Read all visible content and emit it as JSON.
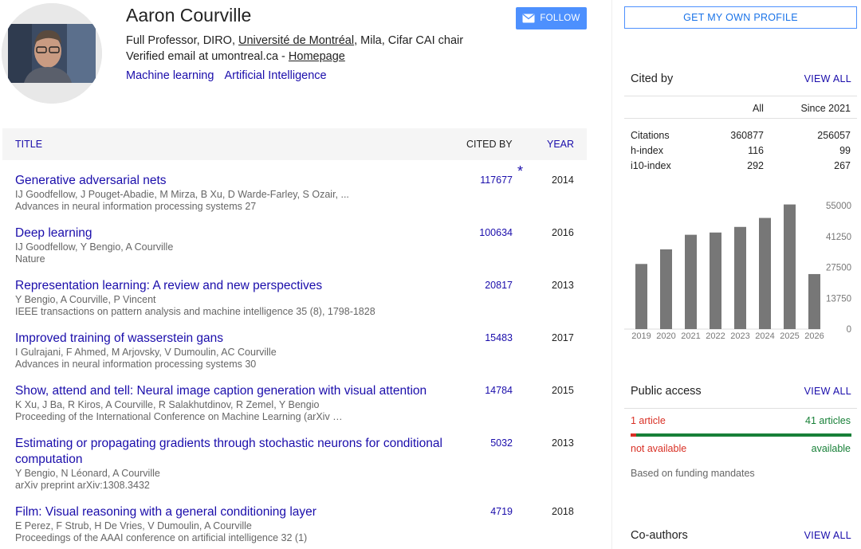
{
  "profile": {
    "name": "Aaron Courville",
    "affiliation_prefix": "Full Professor, DIRO, ",
    "affiliation_link": "Université de Montréal",
    "affiliation_suffix": ", Mila, Cifar CAI chair",
    "email_text": "Verified email at umontreal.ca - ",
    "homepage_label": "Homepage",
    "interests": [
      "Machine learning",
      "Artificial Intelligence"
    ],
    "follow_label": "FOLLOW"
  },
  "table": {
    "headers": {
      "title": "TITLE",
      "cited_by": "CITED BY",
      "year": "YEAR"
    },
    "rows": [
      {
        "title": "Generative adversarial nets",
        "authors": "IJ Goodfellow, J Pouget-Abadie, M Mirza, B Xu, D Warde-Farley, S Ozair, ...",
        "venue": "Advances in neural information processing systems 27",
        "cited": "117677",
        "year": "2014",
        "star": "*"
      },
      {
        "title": "Deep learning",
        "authors": "IJ Goodfellow, Y Bengio, A Courville",
        "venue": "Nature",
        "cited": "100634",
        "year": "2016"
      },
      {
        "title": "Representation learning: A review and new perspectives",
        "authors": "Y Bengio, A Courville, P Vincent",
        "venue": "IEEE transactions on pattern analysis and machine intelligence 35 (8), 1798-1828",
        "cited": "20817",
        "year": "2013"
      },
      {
        "title": "Improved training of wasserstein gans",
        "authors": "I Gulrajani, F Ahmed, M Arjovsky, V Dumoulin, AC Courville",
        "venue": "Advances in neural information processing systems 30",
        "cited": "15483",
        "year": "2017"
      },
      {
        "title": "Show, attend and tell: Neural image caption generation with visual attention",
        "authors": "K Xu, J Ba, R Kiros, A Courville, R Salakhutdinov, R Zemel, Y Bengio",
        "venue": "Proceeding of the International Conference on Machine Learning (arXiv …",
        "cited": "14784",
        "year": "2015"
      },
      {
        "title": "Estimating or propagating gradients through stochastic neurons for conditional computation",
        "authors": "Y Bengio, N Léonard, A Courville",
        "venue": "arXiv preprint arXiv:1308.3432",
        "cited": "5032",
        "year": "2013"
      },
      {
        "title": "Film: Visual reasoning with a general conditioning layer",
        "authors": "E Perez, F Strub, H De Vries, V Dumoulin, A Courville",
        "venue": "Proceedings of the AAAI conference on artificial intelligence 32 (1)",
        "cited": "4719",
        "year": "2018"
      }
    ]
  },
  "sidebar": {
    "get_profile_label": "GET MY OWN PROFILE",
    "cited_by": {
      "title": "Cited by",
      "view_all": "VIEW ALL",
      "col_all": "All",
      "col_since": "Since 2021",
      "rows": [
        {
          "label": "Citations",
          "all": "360877",
          "since": "256057"
        },
        {
          "label": "h-index",
          "all": "116",
          "since": "99"
        },
        {
          "label": "i10-index",
          "all": "292",
          "since": "267"
        }
      ]
    },
    "public_access": {
      "title": "Public access",
      "view_all": "VIEW ALL",
      "left_count": "1 article",
      "right_count": "41 articles",
      "not_available": "not available",
      "available": "available",
      "available_fraction": 0.976,
      "note": "Based on funding mandates"
    },
    "coauthors": {
      "title": "Co-authors",
      "view_all": "VIEW ALL"
    }
  },
  "chart_data": {
    "type": "bar",
    "categories": [
      "2019",
      "2020",
      "2021",
      "2022",
      "2023",
      "2024",
      "2025",
      "2026"
    ],
    "values": [
      29000,
      35500,
      42000,
      43000,
      45500,
      49500,
      55500,
      24500
    ],
    "y_ticks": [
      "55000",
      "41250",
      "27500",
      "13750",
      "0"
    ],
    "ylim": [
      0,
      55000
    ],
    "bar_color": "#777777"
  },
  "colors": {
    "link": "#1a0dab",
    "follow": "#4d90fe",
    "red": "#d93025",
    "green": "#188038"
  }
}
